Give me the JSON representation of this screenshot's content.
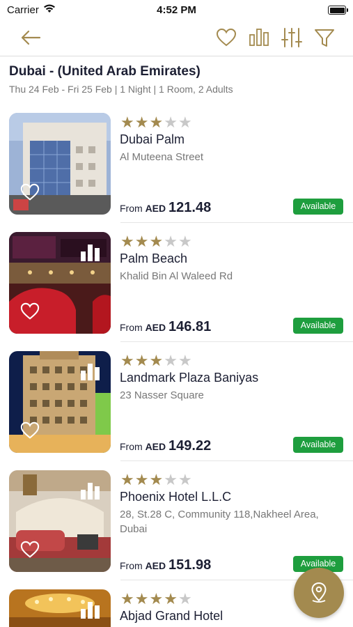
{
  "status_bar": {
    "carrier": "Carrier",
    "time": "4:52 PM"
  },
  "header": {
    "title": "Dubai - (United Arab Emirates)",
    "subtitle": "Thu 24 Feb - Fri 25 Feb | 1 Night | 1 Room, 2 Adults"
  },
  "hotels": [
    {
      "name": "Dubai Palm",
      "address": "Al Muteena Street",
      "stars": 3,
      "price_prefix": "From",
      "currency": "AED",
      "price": "121.48",
      "status": "Available"
    },
    {
      "name": "Palm Beach",
      "address": "Khalid Bin Al Waleed Rd",
      "stars": 3,
      "price_prefix": "From",
      "currency": "AED",
      "price": "146.81",
      "status": "Available"
    },
    {
      "name": "Landmark Plaza Baniyas",
      "address": "23 Nasser Square",
      "stars": 3,
      "price_prefix": "From",
      "currency": "AED",
      "price": "149.22",
      "status": "Available"
    },
    {
      "name": "Phoenix Hotel L.L.C",
      "address": "28, St.28 C, Community 118,Nakheel Area, Dubai",
      "stars": 3,
      "price_prefix": "From",
      "currency": "AED",
      "price": "151.98",
      "status": "Available"
    },
    {
      "name": "Abjad Grand Hotel",
      "address": "",
      "stars": 4,
      "price_prefix": "",
      "currency": "",
      "price": "",
      "status": ""
    }
  ],
  "colors": {
    "accent": "#a38a4f",
    "available": "#1e9e3e",
    "star_off": "#c8c8c8"
  }
}
